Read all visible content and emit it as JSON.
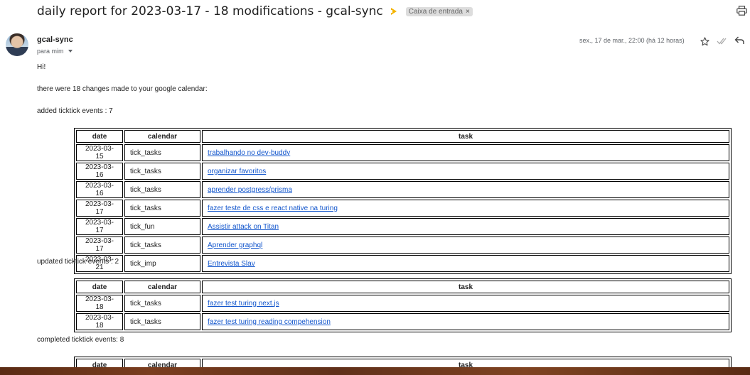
{
  "email": {
    "subject": "daily report for 2023-03-17 - 18 modifications - gcal-sync",
    "label": "Caixa de entrada",
    "label_remove": "×",
    "sender": "gcal-sync",
    "recipient": "para mim",
    "date": "sex., 17 de mar., 22:00 (há 12 horas)"
  },
  "body": {
    "greeting": "Hi!",
    "summary": "there were 18 changes made to your google calendar:",
    "added_heading": "added ticktick events : 7",
    "updated_heading": "updated ticktick events : 2",
    "completed_heading": "completed ticktick events: 8"
  },
  "table_headers": {
    "date": "date",
    "calendar": "calendar",
    "task": "task"
  },
  "added": [
    {
      "date": "2023-03-15",
      "calendar": "tick_tasks",
      "task": "trabalhando no dev-buddy"
    },
    {
      "date": "2023-03-16",
      "calendar": "tick_tasks",
      "task": "organizar favoritos"
    },
    {
      "date": "2023-03-16",
      "calendar": "tick_tasks",
      "task": "aprender postgress/prisma"
    },
    {
      "date": "2023-03-17",
      "calendar": "tick_tasks",
      "task": "fazer teste de css e react native na turing"
    },
    {
      "date": "2023-03-17",
      "calendar": "tick_fun",
      "task": "Assistir attack on Titan"
    },
    {
      "date": "2023-03-17",
      "calendar": "tick_tasks",
      "task": "Aprender graphql"
    },
    {
      "date": "2023-03-21",
      "calendar": "tick_imp",
      "task": "Entrevista Slav"
    }
  ],
  "updated": [
    {
      "date": "2023-03-18",
      "calendar": "tick_tasks",
      "task": "fazer test turing next.js"
    },
    {
      "date": "2023-03-18",
      "calendar": "tick_tasks",
      "task": "fazer test turing reading compehension"
    }
  ],
  "icons": {
    "print": "print-icon",
    "important": "importance-marker-icon",
    "star": "star-icon",
    "read": "double-check-icon",
    "reply": "reply-icon"
  },
  "colors": {
    "link": "#1155cc",
    "importance": "#f4b400",
    "chip": "#dddddd"
  }
}
